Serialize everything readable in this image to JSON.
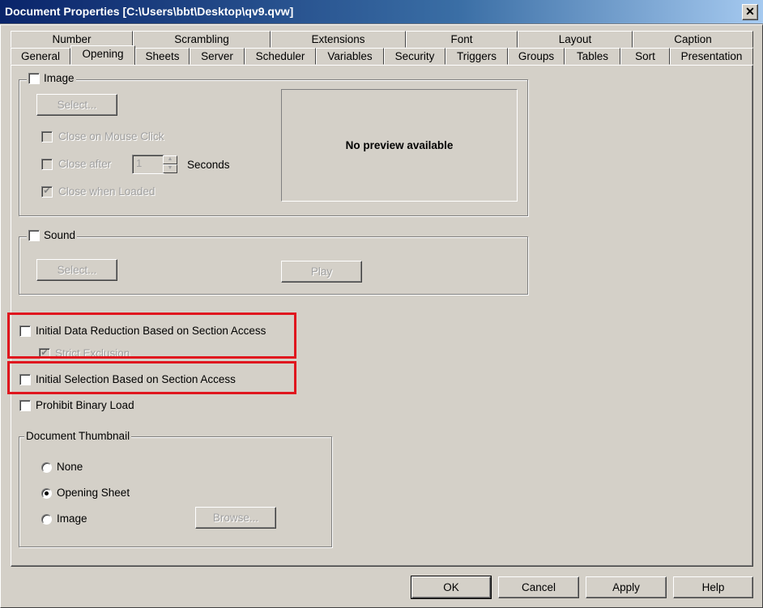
{
  "window": {
    "title": "Document Properties [C:\\Users\\bbt\\Desktop\\qv9.qvw]",
    "close_label": "✕"
  },
  "tabs": {
    "row1": [
      "Number",
      "Scrambling",
      "Extensions",
      "Font",
      "Layout",
      "Caption"
    ],
    "row2": [
      "General",
      "Opening",
      "Sheets",
      "Server",
      "Scheduler",
      "Variables",
      "Security",
      "Triggers",
      "Groups",
      "Tables",
      "Sort",
      "Presentation"
    ],
    "selected": "Opening"
  },
  "image_group": {
    "label": "Image",
    "checked": false,
    "select_button": "Select...",
    "close_on_mouse_click": "Close on Mouse Click",
    "close_after": "Close after",
    "close_after_value": "1",
    "seconds_label": "Seconds",
    "close_when_loaded": "Close when Loaded",
    "preview_text": "No preview available"
  },
  "sound_group": {
    "label": "Sound",
    "checked": false,
    "select_button": "Select...",
    "play_button": "Play"
  },
  "options": {
    "initial_data_reduction": "Initial Data Reduction Based on Section Access",
    "strict_exclusion": "Strict Exclusion",
    "initial_selection": "Initial Selection Based on Section Access",
    "prohibit_binary_load": "Prohibit Binary Load"
  },
  "thumbnail_group": {
    "label": "Document Thumbnail",
    "options": [
      "None",
      "Opening Sheet",
      "Image"
    ],
    "selected": "Opening Sheet",
    "browse_button": "Browse..."
  },
  "footer": {
    "ok": "OK",
    "cancel": "Cancel",
    "apply": "Apply",
    "help": "Help"
  },
  "colors": {
    "highlight": "#e0161e",
    "dialog_bg": "#d4d0c8",
    "title_bar": "#0a246a"
  }
}
